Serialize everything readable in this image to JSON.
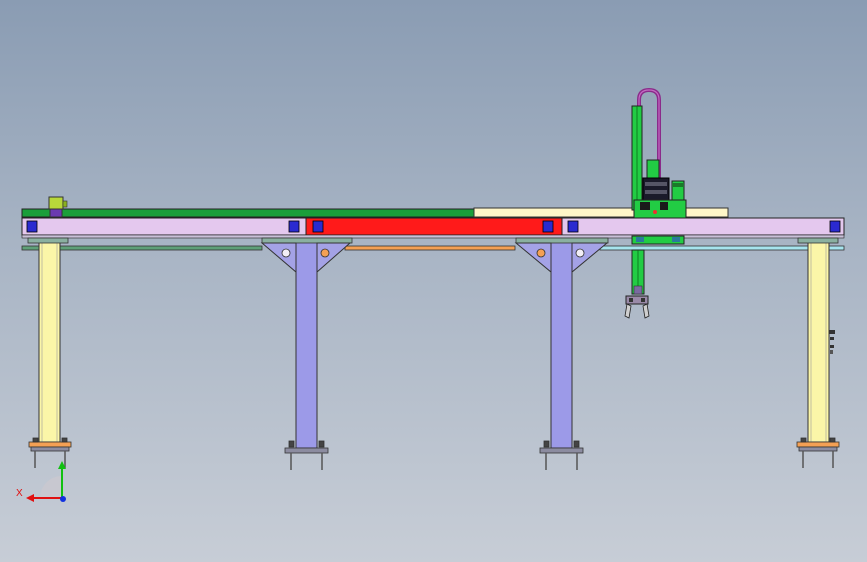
{
  "window": {
    "title": ""
  },
  "viewport": {
    "background_top": "#8a9cb3",
    "background_bottom": "#c7cdd6",
    "model": "gantry-robot-frame-front-view"
  },
  "colors": {
    "beam_light": "#e4c8ee",
    "beam_red": "#ff1a1a",
    "rail_green": "#1a9e3a",
    "rail_cream": "#fff6c8",
    "post_yellow": "#fbf6a8",
    "post_violet": "#9c9ae8",
    "gusset_violet": "#a4a2e6",
    "lower_bar_green": "#5fa078",
    "lower_bar_orange": "#f4a054",
    "lower_bar_cyan": "#a6e4ee",
    "block_blue": "#2a2ad0",
    "carriage_green": "#22cc44",
    "cable_purple": "#8a2a8a"
  },
  "triad": {
    "x_label": "X",
    "x_color": "#e01010",
    "y_color": "#10c010",
    "z_color": "#1030e0"
  }
}
